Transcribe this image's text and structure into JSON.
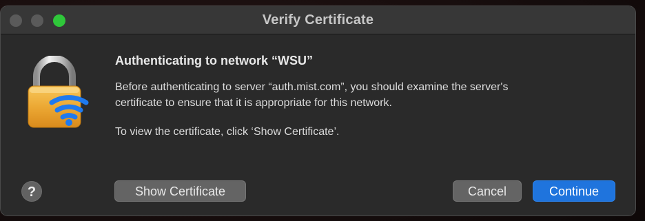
{
  "window": {
    "title": "Verify Certificate"
  },
  "dialog": {
    "icon": "lock-wifi-icon",
    "heading": "Authenticating to network “WSU”",
    "message_line1": "Before authenticating to server “auth.mist.com”, you should examine the server's",
    "message_line2": "certificate to ensure that it is appropriate for this network.",
    "message_line3": "To view the certificate, click ‘Show Certificate’."
  },
  "buttons": {
    "help_label": "?",
    "show_certificate_label": "Show Certificate",
    "cancel_label": "Cancel",
    "continue_label": "Continue"
  },
  "colors": {
    "accent": "#1f74dd",
    "window_bg": "#2a2a2a",
    "titlebar_bg": "#373737",
    "zoom_button": "#2fc73a"
  }
}
